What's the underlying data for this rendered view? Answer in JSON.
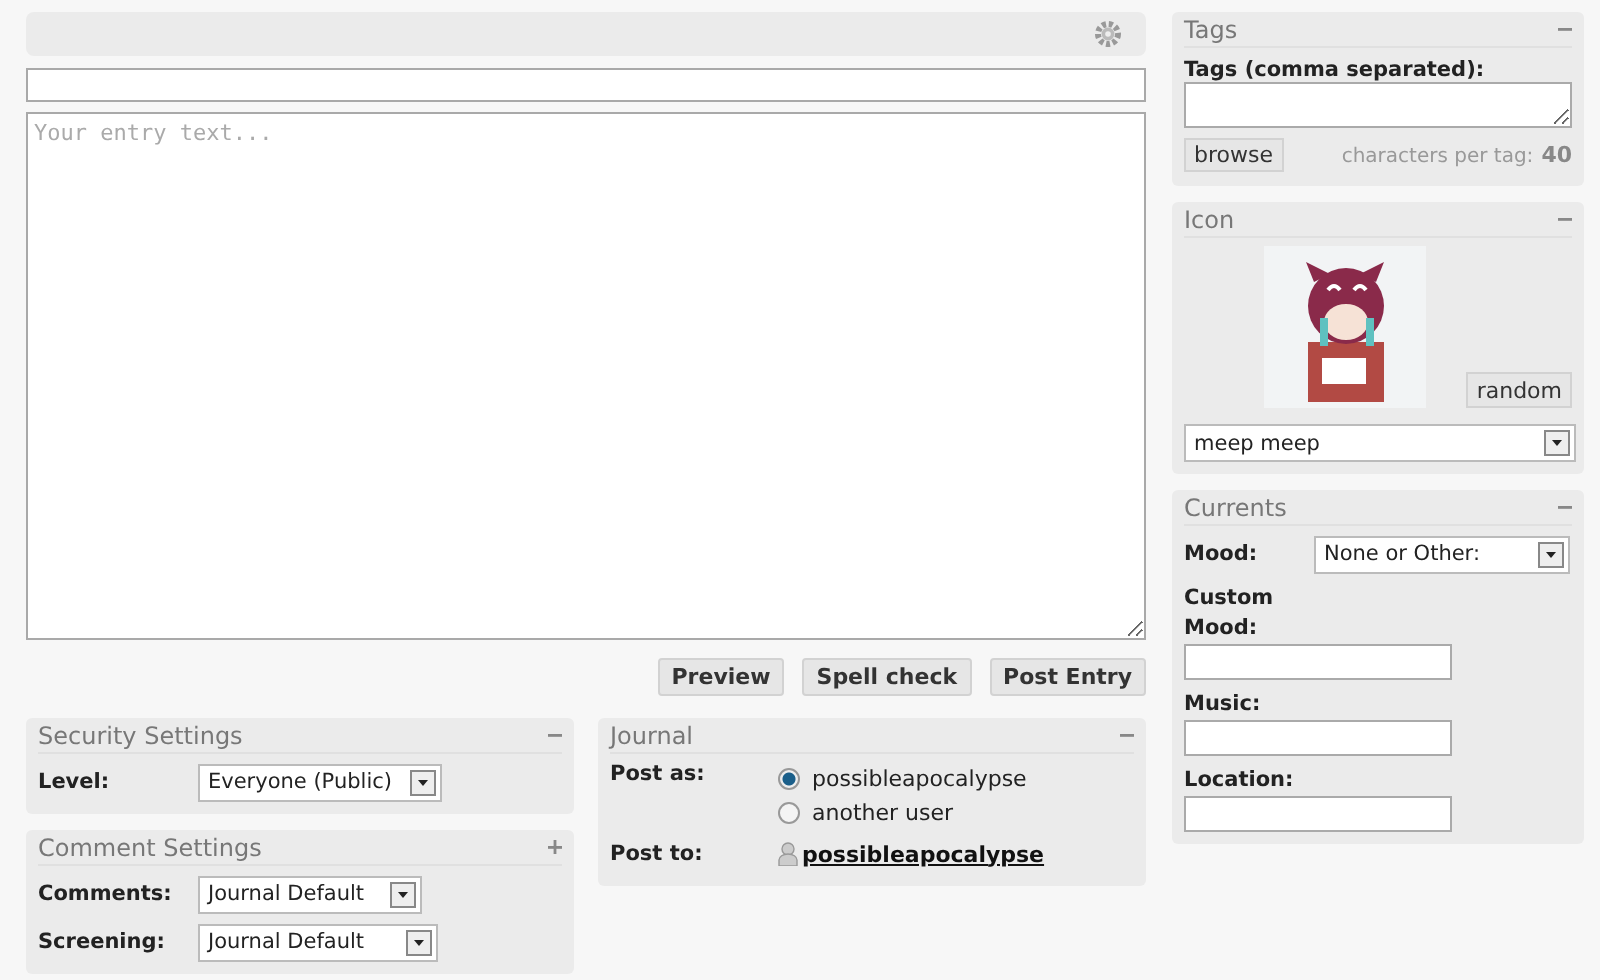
{
  "editor": {
    "body": {
      "placeholder": "Your entry text..."
    },
    "buttons": [
      "Preview",
      "Spell check",
      "Post Entry"
    ]
  },
  "security": {
    "title": "Security Settings",
    "expanded": true,
    "fields": [
      {
        "label": "Level:",
        "value": "Everyone (Public)"
      }
    ]
  },
  "comments": {
    "title": "Comment Settings",
    "expanded": false,
    "fields": [
      {
        "label": "Comments:",
        "value": "Journal Default"
      },
      {
        "label": "Screening:",
        "value": "Journal Default"
      }
    ]
  },
  "journal": {
    "title": "Journal",
    "expanded": true,
    "post_as_label": "Post as:",
    "post_as": [
      {
        "label": "possibleapocalypse",
        "selected": true
      },
      {
        "label": "another user",
        "selected": false
      }
    ],
    "post_to_label": "Post to:",
    "post_to": "possibleapocalypse"
  },
  "tags": {
    "title": "Tags",
    "expanded": true,
    "label": "Tags (comma separated):",
    "browse": "browse",
    "limit_label": "characters per tag:",
    "limit": "40"
  },
  "icon": {
    "title": "Icon",
    "expanded": true,
    "random": "random",
    "selected_icon": "meep meep"
  },
  "currents": {
    "title": "Currents",
    "expanded": true,
    "mood_label": "Mood:",
    "mood": "None or Other:",
    "fields": [
      {
        "label": "Custom Mood:"
      },
      {
        "label": "Music:"
      },
      {
        "label": "Location:"
      }
    ]
  }
}
